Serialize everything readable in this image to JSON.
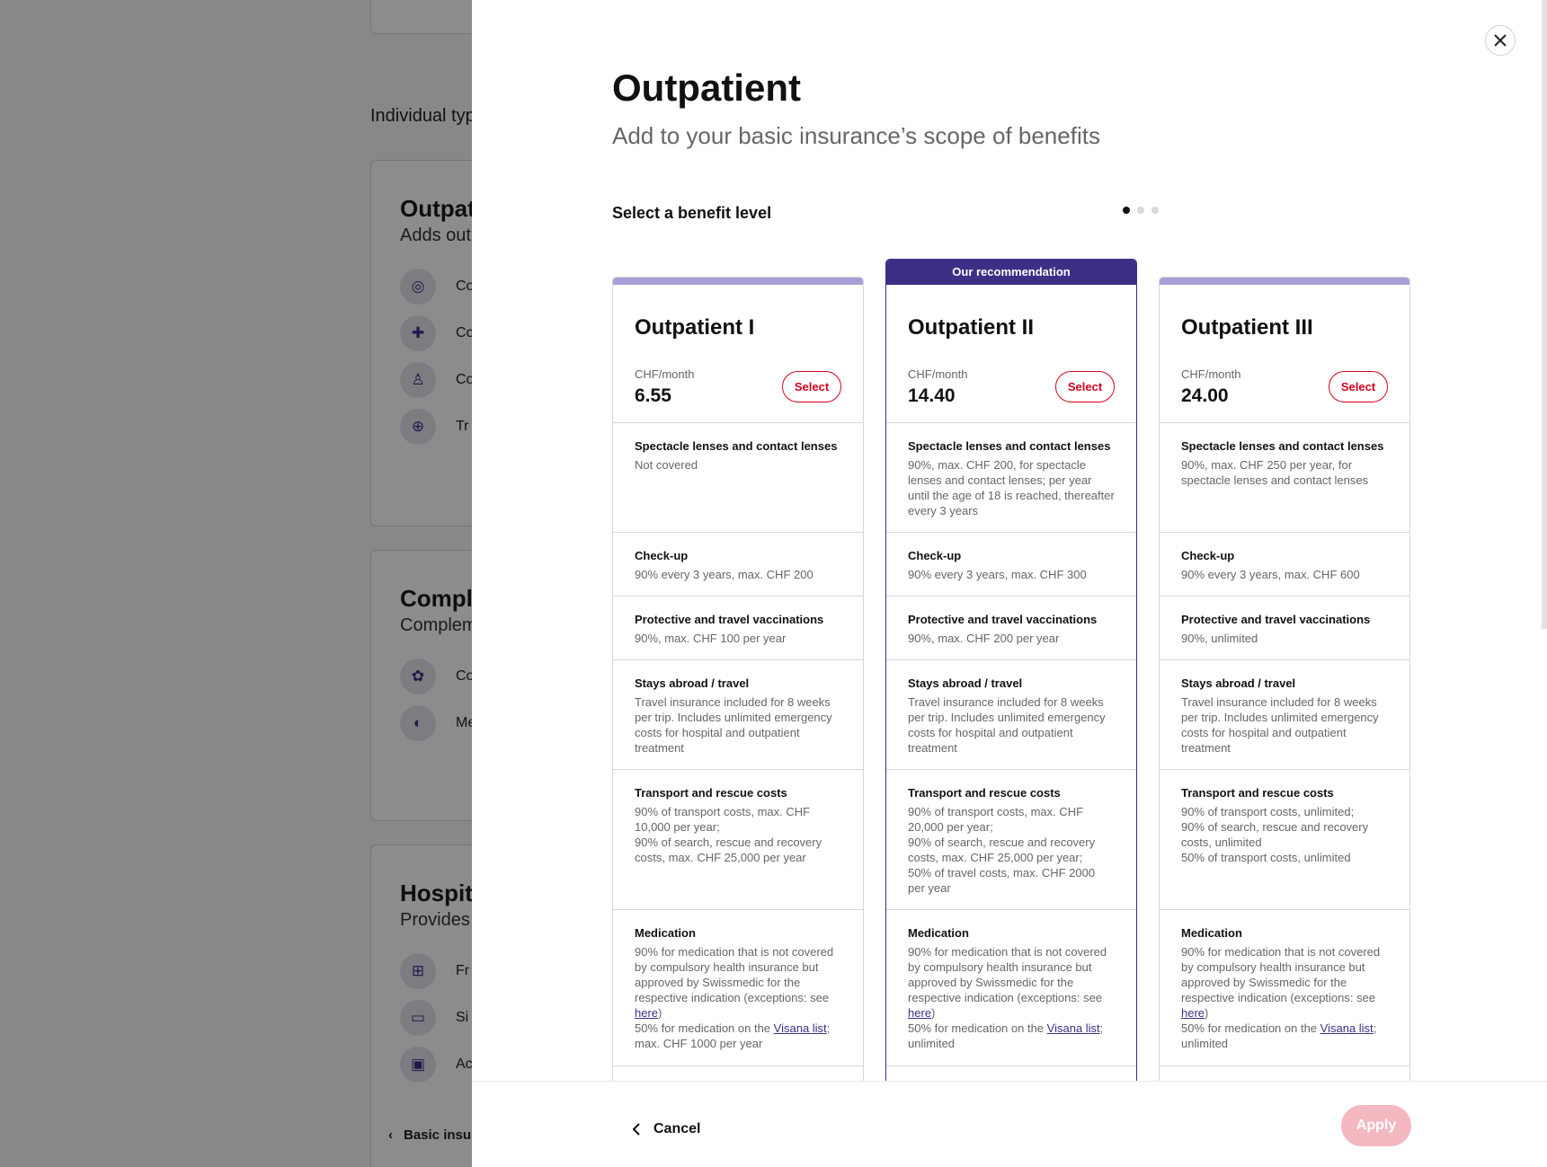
{
  "background": {
    "section_label": "Individual typ",
    "cards": [
      {
        "title": "Outpat",
        "subtitle": "Adds outp",
        "items": [
          {
            "icon": "glasses-icon",
            "label": "Co"
          },
          {
            "icon": "medical-kit-icon",
            "label": "Co"
          },
          {
            "icon": "person-bag-icon",
            "label": "Co"
          },
          {
            "icon": "globe-icon",
            "label": "Tr"
          }
        ]
      },
      {
        "title": "Compl",
        "subtitle": "Complem",
        "items": [
          {
            "icon": "leaf-icon",
            "label": "Co"
          },
          {
            "icon": "pills-icon",
            "label": "Me"
          }
        ]
      },
      {
        "title": "Hospita",
        "subtitle": "Provides r",
        "items": [
          {
            "icon": "hospital-icon",
            "label": "Fr"
          },
          {
            "icon": "bed-icon",
            "label": "Si"
          },
          {
            "icon": "kit-icon",
            "label": "Ac"
          }
        ]
      }
    ],
    "footer_label": "Basic insu"
  },
  "modal": {
    "title": "Outpatient",
    "subtitle": "Add to your basic insurance’s scope of benefits",
    "select_label": "Select a benefit level",
    "recommendation_label": "Our recommendation",
    "unit_label": "CHF/month",
    "select_button": "Select",
    "cancel_label": "Cancel",
    "apply_label": "Apply",
    "colors": {
      "accent": "#3d2f86",
      "select": "#d6001c",
      "apply_disabled": "#f4b8c0"
    },
    "plans": [
      {
        "name": "Outpatient I",
        "price": "6.55",
        "benefits": [
          {
            "title": "Spectacle lenses and contact lenses",
            "text": "Not covered"
          },
          {
            "title": "Check-up",
            "text": "90% every 3 years, max. CHF 200"
          },
          {
            "title": "Protective and travel vaccinations",
            "text": "90%, max. CHF 100 per year"
          },
          {
            "title": "Stays abroad / travel",
            "text": "Travel insurance included for 8 weeks per trip. Includes unlimited emergency costs for hospital and outpatient treatment"
          },
          {
            "title": "Transport and rescue costs",
            "text": "90% of transport costs, max. CHF 10,000 per year;\n90% of search, rescue and recovery costs, max. CHF 25,000 per year"
          },
          {
            "title": "Medication",
            "text_a": "90% for medication that is not covered by compulsory health insurance but approved by Swissmedic for the respective indication (exceptions: see ",
            "link1": "here",
            "text_b": ")\n50% for medication on the ",
            "link2": "Visana list",
            "text_c": ";\nmax. CHF 1000 per year"
          }
        ]
      },
      {
        "name": "Outpatient II",
        "price": "14.40",
        "benefits": [
          {
            "title": "Spectacle lenses and contact lenses",
            "text": "90%, max. CHF 200, for spectacle lenses and contact lenses; per year until the age of 18 is reached, thereafter every 3 years"
          },
          {
            "title": "Check-up",
            "text": "90% every 3 years, max. CHF 300"
          },
          {
            "title": "Protective and travel vaccinations",
            "text": "90%, max. CHF 200 per year"
          },
          {
            "title": "Stays abroad / travel",
            "text": "Travel insurance included for 8 weeks per trip. Includes unlimited emergency costs for hospital and outpatient treatment"
          },
          {
            "title": "Transport and rescue costs",
            "text": "90% of transport costs, max. CHF 20,000 per year;\n90% of search, rescue and recovery costs, max. CHF 25,000 per year;\n50% of travel costs, max. CHF 2000 per year"
          },
          {
            "title": "Medication",
            "text_a": "90% for medication that is not covered by compulsory health insurance but approved by Swissmedic for the respective indication (exceptions: see ",
            "link1": "here",
            "text_b": ")\n50% for medication on the ",
            "link2": "Visana list",
            "text_c": ";\nunlimited"
          }
        ]
      },
      {
        "name": "Outpatient III",
        "price": "24.00",
        "benefits": [
          {
            "title": "Spectacle lenses and contact lenses",
            "text": "90%, max. CHF 250 per year, for spectacle lenses and contact lenses"
          },
          {
            "title": "Check-up",
            "text": "90% every 3 years, max. CHF 600"
          },
          {
            "title": "Protective and travel vaccinations",
            "text": "90%, unlimited"
          },
          {
            "title": "Stays abroad / travel",
            "text": "Travel insurance included for 8 weeks per trip. Includes unlimited emergency costs for hospital and outpatient treatment"
          },
          {
            "title": "Transport and rescue costs",
            "text": "90% of transport costs, unlimited;\n90% of search, rescue and recovery costs, unlimited\n50% of transport costs, unlimited"
          },
          {
            "title": "Medication",
            "text_a": "90% for medication that is not covered by compulsory health insurance but approved by Swissmedic for the respective indication (exceptions: see ",
            "link1": "here",
            "text_b": ")\n50% for medication on the ",
            "link2": "Visana list",
            "text_c": ";\nunlimited"
          }
        ]
      }
    ]
  }
}
